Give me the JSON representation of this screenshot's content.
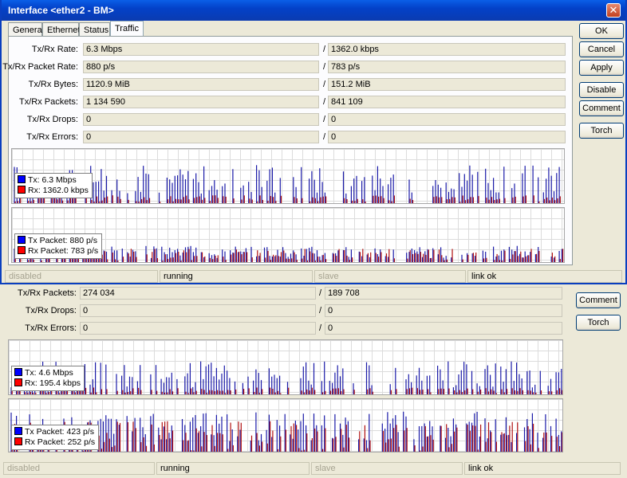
{
  "front": {
    "title": "Interface <ether2 - BM>",
    "close_glyph": "✕",
    "tabs": [
      {
        "label": "General"
      },
      {
        "label": "Ethernet"
      },
      {
        "label": "Status"
      },
      {
        "label": "Traffic"
      }
    ],
    "fields": [
      {
        "label": "Tx/Rx Rate:",
        "tx": "6.3 Mbps",
        "rx": "1362.0 kbps"
      },
      {
        "label": "Tx/Rx Packet Rate:",
        "tx": "880 p/s",
        "rx": "783 p/s"
      },
      {
        "label": "Tx/Rx Bytes:",
        "tx": "1120.9 MiB",
        "rx": "151.2 MiB"
      },
      {
        "label": "Tx/Rx Packets:",
        "tx": "1 134 590",
        "rx": "841 109"
      },
      {
        "label": "Tx/Rx Drops:",
        "tx": "0",
        "rx": "0"
      },
      {
        "label": "Tx/Rx Errors:",
        "tx": "0",
        "rx": "0"
      }
    ],
    "traffic_legend": {
      "tx": "Tx:  6.3 Mbps",
      "rx": "Rx:  1362.0 kbps"
    },
    "packet_legend": {
      "tx": "Tx Packet:  880 p/s",
      "rx": "Rx Packet:  783 p/s"
    },
    "buttons": [
      "OK",
      "Cancel",
      "Apply",
      "Disable",
      "Comment",
      "Torch"
    ],
    "status": [
      "disabled",
      "running",
      "slave",
      "link ok"
    ]
  },
  "back": {
    "fields": [
      {
        "label": "Tx/Rx Packets:",
        "tx": "274 034",
        "rx": "189 708"
      },
      {
        "label": "Tx/Rx Drops:",
        "tx": "0",
        "rx": "0"
      },
      {
        "label": "Tx/Rx Errors:",
        "tx": "0",
        "rx": "0"
      }
    ],
    "traffic_legend": {
      "tx": "Tx:  4.6 Mbps",
      "rx": "Rx:  195.4 kbps"
    },
    "packet_legend": {
      "tx": "Tx Packet:  423 p/s",
      "rx": "Rx Packet:  252 p/s"
    },
    "buttons": [
      "Comment",
      "Torch"
    ],
    "status": [
      "disabled",
      "running",
      "slave",
      "link ok"
    ]
  },
  "colors": {
    "tx": "#1a1aa8",
    "rx": "#b01010",
    "tx_swatch": "#0000ff",
    "rx_swatch": "#ff0000"
  },
  "icons": {
    "close": "close-icon"
  }
}
